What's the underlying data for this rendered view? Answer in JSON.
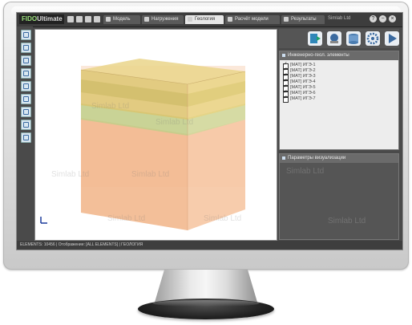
{
  "app": {
    "logo_prefix": "FIDO",
    "logo_suffix": "Ultimate",
    "brand_right": "Simlab Ltd",
    "tabs": [
      {
        "label": "Модель",
        "active": false
      },
      {
        "label": "Нагружения",
        "active": false
      },
      {
        "label": "Геология",
        "active": true
      },
      {
        "label": "Расчёт модели",
        "active": false
      },
      {
        "label": "Результаты",
        "active": false
      }
    ]
  },
  "panel": {
    "title": "Инженерно-геол. элементы",
    "layers": [
      "[MAT] ИГЭ-1",
      "[MAT] ИГЭ-2",
      "[MAT] ИГЭ-3",
      "[MAT] ИГЭ-4",
      "[MAT] ИГЭ-5",
      "[MAT] ИГЭ-6",
      "[MAT] ИГЭ-7"
    ]
  },
  "panel2": {
    "title": "Параметры визуализации"
  },
  "viewport": {
    "watermark": "Simlab Ltd",
    "axis_label": "L"
  },
  "statusbar": {
    "text": "ELEMENTS: 10456 | Отображение: [ALL ELEMENTS] | ГЕОЛОГИЯ"
  },
  "colors": {
    "soil_lower": "#f4b88a",
    "soil_upper": "#e6c86a",
    "soil_green": "#b9d08a",
    "bezel": "#d9d9d9",
    "screen_bg": "#4a4a4a"
  }
}
